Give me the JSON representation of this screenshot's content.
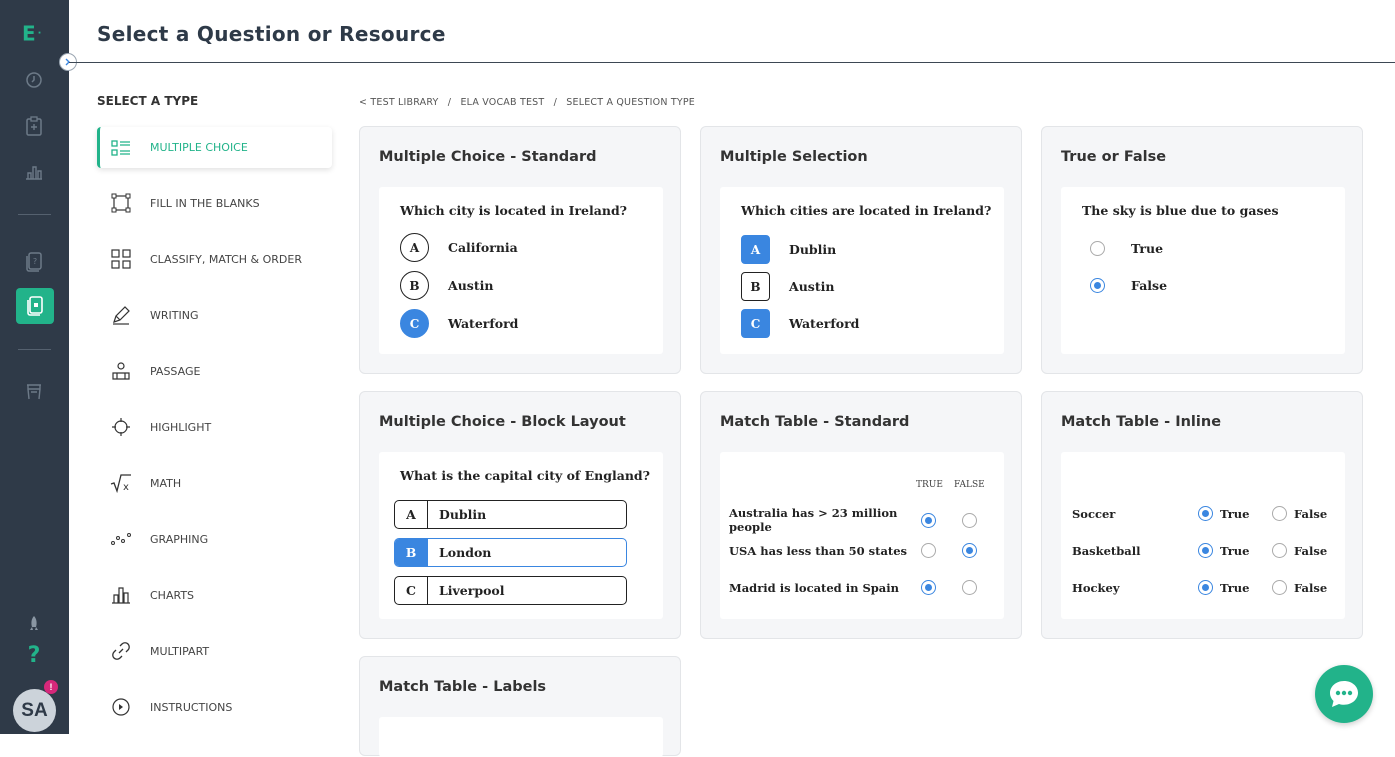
{
  "app": {
    "logo": "E",
    "avatar_initials": "SA",
    "avatar_badge": "!"
  },
  "header": {
    "title": "Select a Question or Resource"
  },
  "types": {
    "heading": "SELECT A TYPE",
    "items": [
      {
        "label": "MULTIPLE CHOICE",
        "icon": "list-icon",
        "active": true
      },
      {
        "label": "FILL IN THE BLANKS",
        "icon": "blank-frame-icon"
      },
      {
        "label": "CLASSIFY, MATCH & ORDER",
        "icon": "grid-icon"
      },
      {
        "label": "WRITING",
        "icon": "pen-icon"
      },
      {
        "label": "PASSAGE",
        "icon": "passage-icon"
      },
      {
        "label": "HIGHLIGHT",
        "icon": "crosshair-icon"
      },
      {
        "label": "MATH",
        "icon": "sqrt-icon"
      },
      {
        "label": "GRAPHING",
        "icon": "graph-icon"
      },
      {
        "label": "CHARTS",
        "icon": "bar-chart-icon"
      },
      {
        "label": "MULTIPART",
        "icon": "link-icon"
      },
      {
        "label": "INSTRUCTIONS",
        "icon": "play-circle-icon"
      }
    ]
  },
  "breadcrumb": {
    "back": "< TEST LIBRARY",
    "sep": "/",
    "middle": "ELA VOCAB TEST",
    "current": "SELECT A QUESTION TYPE"
  },
  "cards": {
    "mc_standard": {
      "title": "Multiple Choice - Standard",
      "question": "Which city is located in Ireland?",
      "options": [
        {
          "letter": "A",
          "text": "California"
        },
        {
          "letter": "B",
          "text": "Austin"
        },
        {
          "letter": "C",
          "text": "Waterford"
        }
      ]
    },
    "multi_select": {
      "title": "Multiple Selection",
      "question": "Which cities are located in Ireland?",
      "options": [
        {
          "letter": "A",
          "text": "Dublin"
        },
        {
          "letter": "B",
          "text": "Austin"
        },
        {
          "letter": "C",
          "text": "Waterford"
        }
      ]
    },
    "true_false": {
      "title": "True or False",
      "question": "The sky is blue due to gases",
      "options": [
        {
          "text": "True"
        },
        {
          "text": "False"
        }
      ]
    },
    "mc_block": {
      "title": "Multiple Choice - Block Layout",
      "question": "What is the capital city of England?",
      "options": [
        {
          "letter": "A",
          "text": "Dublin"
        },
        {
          "letter": "B",
          "text": "London"
        },
        {
          "letter": "C",
          "text": "Liverpool"
        }
      ]
    },
    "match_standard": {
      "title": "Match Table - Standard",
      "col_true": "TRUE",
      "col_false": "FALSE",
      "rows": [
        {
          "text": "Australia has > 23 million people"
        },
        {
          "text": "USA has less than 50 states"
        },
        {
          "text": "Madrid is located in Spain"
        }
      ]
    },
    "match_inline": {
      "title": "Match Table - Inline",
      "true_label": "True",
      "false_label": "False",
      "rows": [
        {
          "text": "Soccer"
        },
        {
          "text": "Basketball"
        },
        {
          "text": "Hockey"
        }
      ]
    },
    "match_labels": {
      "title": "Match Table - Labels"
    }
  },
  "colors": {
    "accent": "#22b38a",
    "selected": "#3a86e0",
    "rail": "#2f3a48"
  }
}
